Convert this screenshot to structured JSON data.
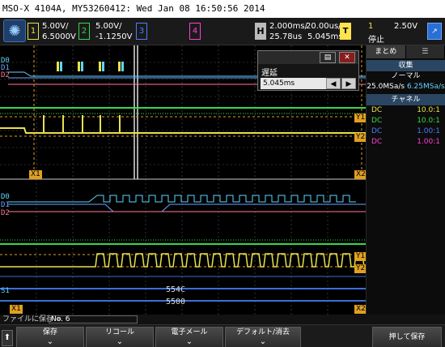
{
  "title": "MSO-X 4104A, MY53260412: Wed Jan 08 16:50:56 2014",
  "topbar": {
    "ch1": {
      "num": "1",
      "scale": "5.00V/",
      "offset": "6.5000V",
      "color": "#e8e24a"
    },
    "ch2": {
      "num": "2",
      "scale": "5.00V/",
      "offset": "-1.1250V",
      "color": "#3ad64a"
    },
    "ch3": {
      "num": "3",
      "color": "#4a7eff"
    },
    "ch4": {
      "num": "4",
      "color": "#ff3fd0"
    },
    "horiz": {
      "label": "H",
      "time_div": "2.000ms/",
      "position": "25.78us",
      "zoom_div": "20.00us/",
      "zoom_pos": "5.045ms"
    },
    "trigger": {
      "label": "T",
      "number": "1",
      "state": "停止",
      "level": "2.50V"
    }
  },
  "side": {
    "tabs": [
      "まとめ",
      "☰"
    ],
    "acq_header": "収集",
    "acq_mode": "ノーマル",
    "acq_rate1": "25.0MSa/s",
    "acq_rate2": "6.25MSa/s",
    "ch_header": "チャネル",
    "channels": [
      {
        "coupling": "DC",
        "probe": "10.0:1",
        "color": "#e8e24a"
      },
      {
        "coupling": "DC",
        "probe": "10.0:1",
        "color": "#3ad64a"
      },
      {
        "coupling": "DC",
        "probe": "1.00:1",
        "color": "#4a7eff"
      },
      {
        "coupling": "DC",
        "probe": "1.00:1",
        "color": "#ff3fd0"
      }
    ]
  },
  "delay_dialog": {
    "title": "遅延",
    "value": "5.045ms"
  },
  "bus_values": [
    "554C",
    "5500"
  ],
  "markers": {
    "x1": "X1",
    "x2": "X2",
    "y1": "Y1",
    "y2": "Y2"
  },
  "channel_labels": {
    "d0": "D0",
    "d1": "D1",
    "d2": "D2",
    "s1": "S1"
  },
  "save_bar": {
    "label": "ファイルに保存 =",
    "value": "No. 6"
  },
  "softkeys": [
    "保存",
    "リコール",
    "電子メール",
    "デフォルト/消去",
    "押して保存"
  ]
}
